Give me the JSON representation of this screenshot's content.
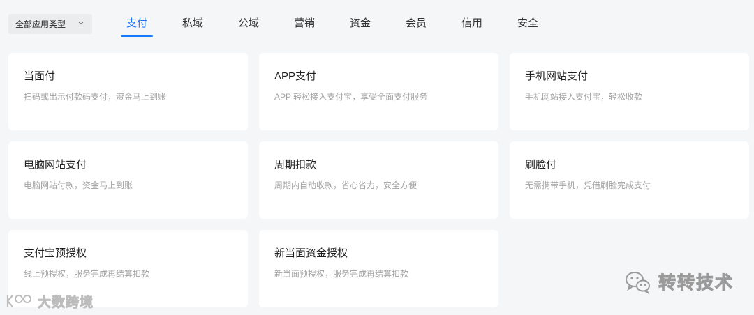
{
  "filter": {
    "label": "全部应用类型",
    "icon": "chevron-down-icon"
  },
  "tabs": [
    {
      "label": "支付"
    },
    {
      "label": "私域"
    },
    {
      "label": "公域"
    },
    {
      "label": "营销"
    },
    {
      "label": "资金"
    },
    {
      "label": "会员"
    },
    {
      "label": "信用"
    },
    {
      "label": "安全"
    }
  ],
  "active_tab": "支付",
  "accent_color": "#1677ff",
  "cards": [
    {
      "title": "当面付",
      "desc": "扫码或出示付款码支付，资金马上到账"
    },
    {
      "title": "APP支付",
      "desc": "APP 轻松接入支付宝，享受全面支付服务"
    },
    {
      "title": "手机网站支付",
      "desc": "手机网站接入支付宝，轻松收款"
    },
    {
      "title": "电脑网站支付",
      "desc": "电脑网站付款，资金马上到账"
    },
    {
      "title": "周期扣款",
      "desc": "周期内自动收款，省心省力，安全方便"
    },
    {
      "title": "刷脸付",
      "desc": "无需携带手机，凭借刷脸完成支付"
    },
    {
      "title": "支付宝预授权",
      "desc": "线上预授权，服务完成再结算扣款"
    },
    {
      "title": "新当面资金授权",
      "desc": "新当面预授权，服务完成再结算扣款"
    }
  ],
  "watermarks": {
    "right": {
      "text": "转转技术",
      "icon": "wechat-icon"
    },
    "left": {
      "text": "大数跨境",
      "icon": "brand-logo-icon"
    }
  }
}
